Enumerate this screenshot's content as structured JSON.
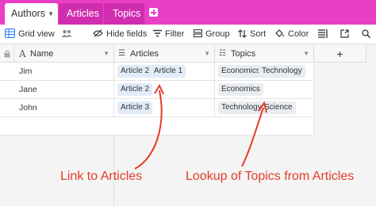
{
  "tabs": [
    {
      "label": "Authors",
      "active": true
    },
    {
      "label": "Articles",
      "active": false
    },
    {
      "label": "Topics",
      "active": false
    }
  ],
  "toolbar": {
    "view_name": "Grid view",
    "hide_fields": "Hide fields",
    "filter": "Filter",
    "group": "Group",
    "sort": "Sort",
    "color": "Color"
  },
  "columns": {
    "name": "Name",
    "articles": "Articles",
    "topics": "Topics"
  },
  "rows": [
    {
      "name": "Jim",
      "articles": [
        "Article 2",
        "Article 1"
      ],
      "topics": [
        "Economics",
        "Technology"
      ]
    },
    {
      "name": "Jane",
      "articles": [
        "Article 2"
      ],
      "topics": [
        "Economics"
      ]
    },
    {
      "name": "John",
      "articles": [
        "Article 3"
      ],
      "topics": [
        "Technology",
        "Science"
      ]
    }
  ],
  "annotations": {
    "link": "Link to Articles",
    "lookup": "Lookup of Topics from Articles"
  },
  "colors": {
    "tab_bar": "#e93ec6",
    "annotation": "#e53c25",
    "link_pill": "#e2ecf9",
    "lookup_pill": "#e9edf2"
  }
}
